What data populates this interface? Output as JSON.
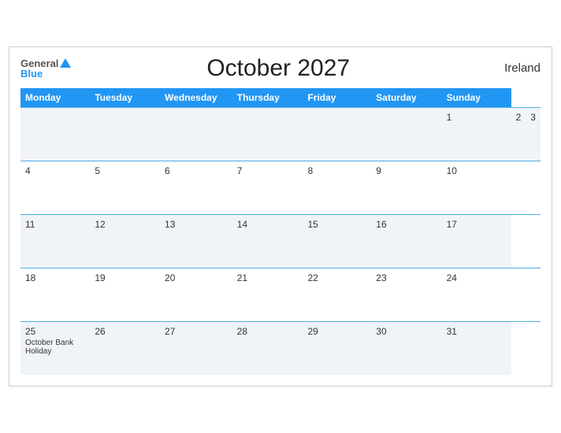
{
  "header": {
    "logo_general": "General",
    "logo_blue": "Blue",
    "title": "October 2027",
    "country": "Ireland"
  },
  "columns": [
    "Monday",
    "Tuesday",
    "Wednesday",
    "Thursday",
    "Friday",
    "Saturday",
    "Sunday"
  ],
  "rows": [
    [
      {
        "num": "",
        "event": ""
      },
      {
        "num": "",
        "event": ""
      },
      {
        "num": "",
        "event": ""
      },
      {
        "num": "1",
        "event": ""
      },
      {
        "num": "2",
        "event": ""
      },
      {
        "num": "3",
        "event": ""
      }
    ],
    [
      {
        "num": "4",
        "event": ""
      },
      {
        "num": "5",
        "event": ""
      },
      {
        "num": "6",
        "event": ""
      },
      {
        "num": "7",
        "event": ""
      },
      {
        "num": "8",
        "event": ""
      },
      {
        "num": "9",
        "event": ""
      },
      {
        "num": "10",
        "event": ""
      }
    ],
    [
      {
        "num": "11",
        "event": ""
      },
      {
        "num": "12",
        "event": ""
      },
      {
        "num": "13",
        "event": ""
      },
      {
        "num": "14",
        "event": ""
      },
      {
        "num": "15",
        "event": ""
      },
      {
        "num": "16",
        "event": ""
      },
      {
        "num": "17",
        "event": ""
      }
    ],
    [
      {
        "num": "18",
        "event": ""
      },
      {
        "num": "19",
        "event": ""
      },
      {
        "num": "20",
        "event": ""
      },
      {
        "num": "21",
        "event": ""
      },
      {
        "num": "22",
        "event": ""
      },
      {
        "num": "23",
        "event": ""
      },
      {
        "num": "24",
        "event": ""
      }
    ],
    [
      {
        "num": "25",
        "event": "October Bank Holiday"
      },
      {
        "num": "26",
        "event": ""
      },
      {
        "num": "27",
        "event": ""
      },
      {
        "num": "28",
        "event": ""
      },
      {
        "num": "29",
        "event": ""
      },
      {
        "num": "30",
        "event": ""
      },
      {
        "num": "31",
        "event": ""
      }
    ]
  ]
}
